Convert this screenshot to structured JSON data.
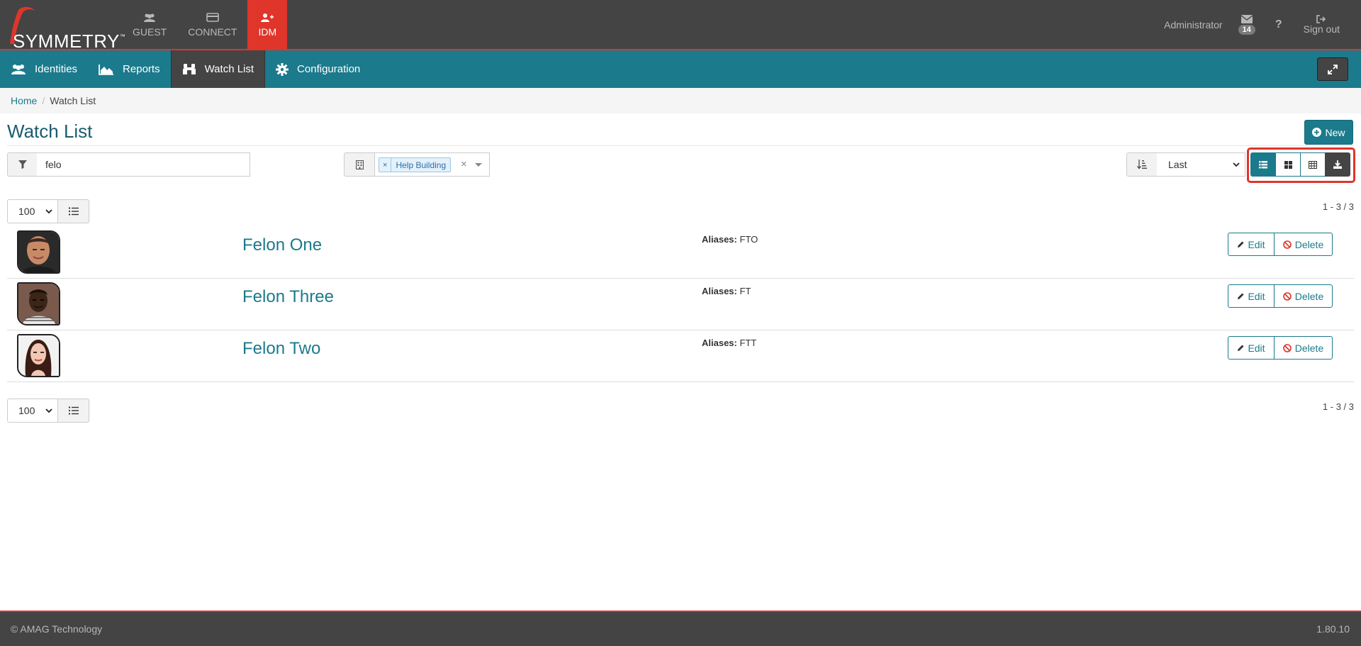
{
  "app": {
    "logo_text": "SYMMETRY",
    "logo_tm": "™",
    "accent": "#e0352b",
    "teal": "#1b7a8c",
    "dark": "#444444"
  },
  "topnav": {
    "items": [
      {
        "label": "GUEST",
        "icon": "users-icon"
      },
      {
        "label": "CONNECT",
        "icon": "card-icon"
      },
      {
        "label": "IDM",
        "icon": "user-plus-icon",
        "active": true
      }
    ],
    "user_label": "Administrator",
    "mail_count": "14",
    "help_label": "?",
    "signout_label": "Sign out"
  },
  "subnav": {
    "items": [
      {
        "label": "Identities",
        "icon": "users-icon"
      },
      {
        "label": "Reports",
        "icon": "area-chart-icon"
      },
      {
        "label": "Watch List",
        "icon": "binoculars-icon",
        "active": true
      },
      {
        "label": "Configuration",
        "icon": "gear-icon"
      }
    ]
  },
  "breadcrumb": {
    "home": "Home",
    "current": "Watch List"
  },
  "page": {
    "title": "Watch List",
    "new_label": "New"
  },
  "filters": {
    "search_value": "felo",
    "building_tag": "Help Building",
    "tag_remove": "×",
    "clear": "×",
    "sort_value": "Last"
  },
  "paging": {
    "page_size": "100",
    "count_text": "1 - 3 / 3"
  },
  "rows": [
    {
      "name": "Felon One",
      "aliases_label": "Aliases:",
      "aliases": "FTO",
      "edit": "Edit",
      "delete": "Delete"
    },
    {
      "name": "Felon Three",
      "aliases_label": "Aliases:",
      "aliases": "FT",
      "edit": "Edit",
      "delete": "Delete"
    },
    {
      "name": "Felon Two",
      "aliases_label": "Aliases:",
      "aliases": "FTT",
      "edit": "Edit",
      "delete": "Delete"
    }
  ],
  "footer": {
    "copyright": "© AMAG Technology",
    "version": "1.80.10"
  }
}
